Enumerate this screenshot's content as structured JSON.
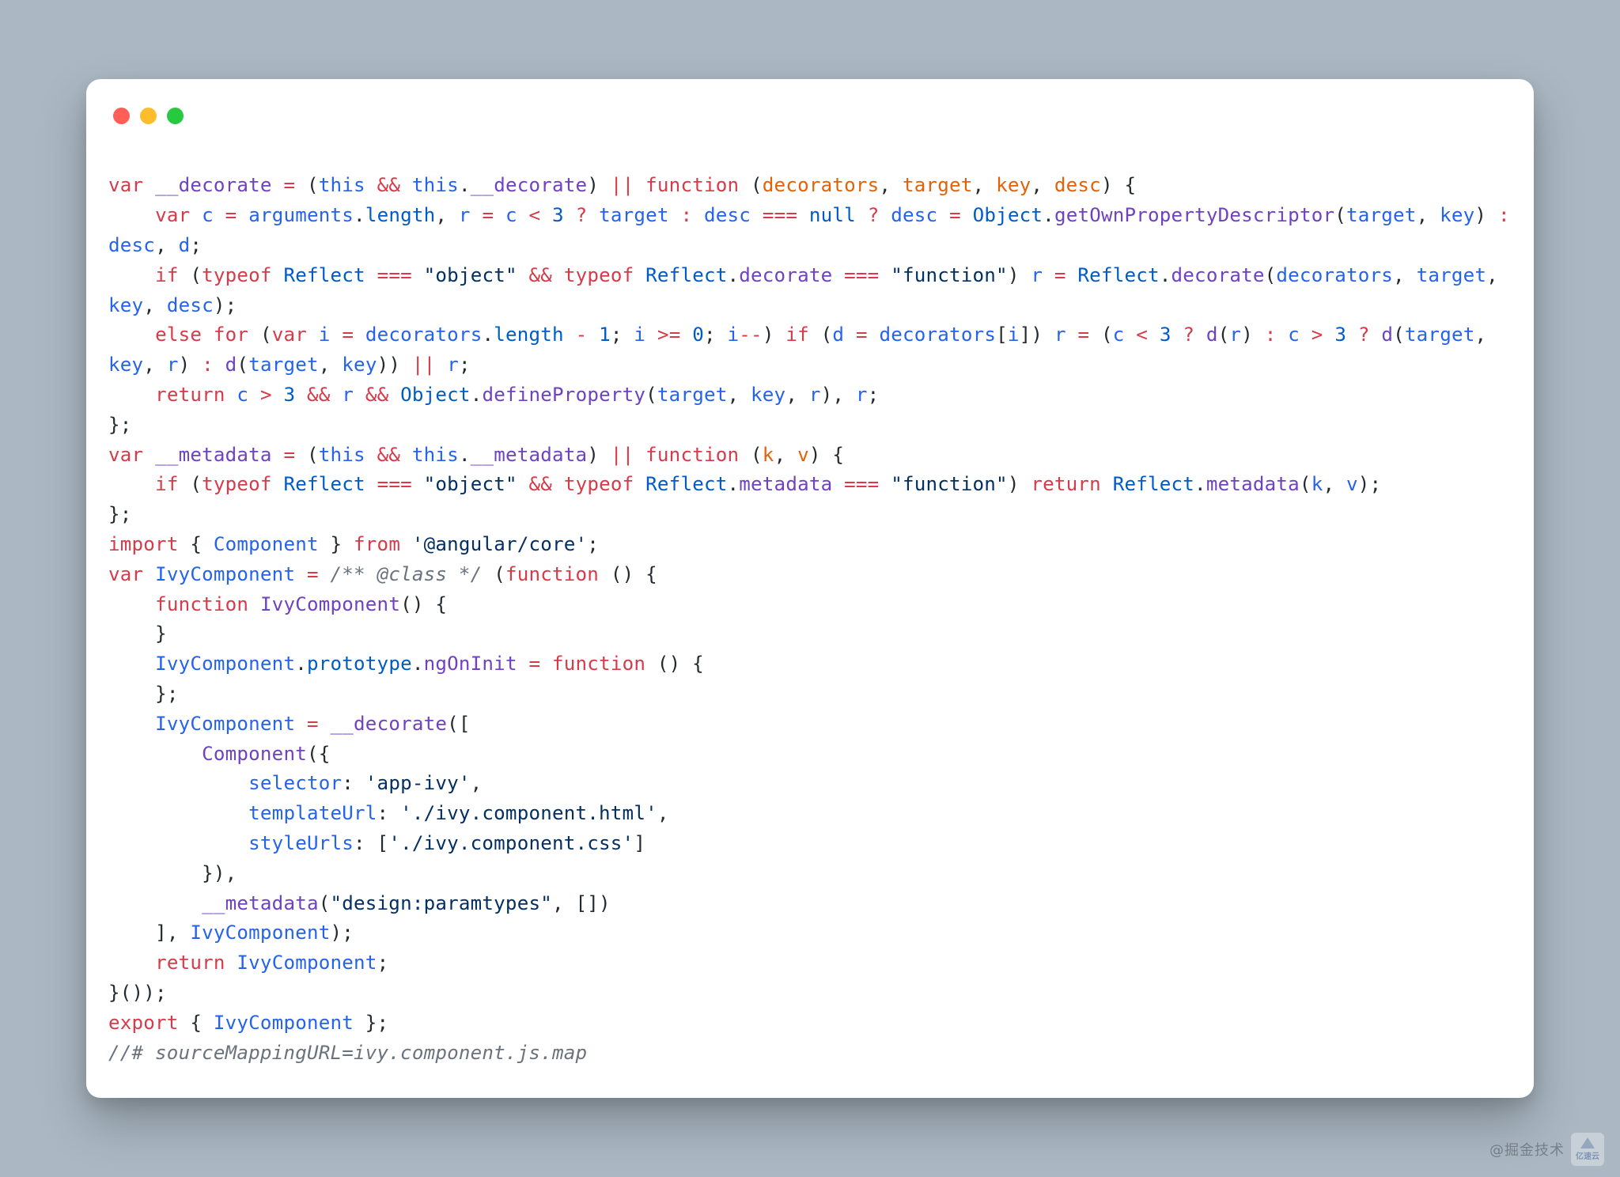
{
  "window": {
    "dot_colors": {
      "red": "#ff5f56",
      "yellow": "#ffbd2e",
      "green": "#27c93f"
    }
  },
  "syntax_colors": {
    "keyword": "#d73a49",
    "function": "#6f42c1",
    "identifier": "#2563eb",
    "property": "#005cc5",
    "number": "#005cc5",
    "string": "#032f62",
    "param": "#e36209",
    "comment": "#6a737d",
    "plain": "#24292e"
  },
  "code_meta": {
    "language": "javascript",
    "file_guess": "ivy.component.js"
  },
  "t": {
    "var": "var",
    "this": "this",
    "function": "function",
    "if": "if",
    "else": "else",
    "for": "for",
    "typeof": "typeof",
    "return": "return",
    "import": "import",
    "from": "from",
    "export": "export",
    "null": "null",
    "__decorate": "__decorate",
    "__metadata": "__metadata",
    "decorators": "decorators",
    "target": "target",
    "key": "key",
    "desc": "desc",
    "c": "c",
    "arguments": "arguments",
    "length": "length",
    "r": "r",
    "d": "d",
    "i": "i",
    "k": "k",
    "v": "v",
    "Object": "Object",
    "getOwnPropertyDescriptor": "getOwnPropertyDescriptor",
    "defineProperty": "defineProperty",
    "Reflect": "Reflect",
    "decorate": "decorate",
    "metadata": "metadata",
    "Component": "Component",
    "IvyComponent": "IvyComponent",
    "prototype": "prototype",
    "ngOnInit": "ngOnInit",
    "selector": "selector",
    "templateUrl": "templateUrl",
    "styleUrls": "styleUrls",
    "n3": "3",
    "n1": "1",
    "n0": "0",
    "s_object": "\"object\"",
    "s_function": "\"function\"",
    "s_angular_core": "'@angular/core'",
    "s_app_ivy": "'app-ivy'",
    "s_tpl": "'./ivy.component.html'",
    "s_css": "'./ivy.component.css'",
    "s_design_paramtypes": "\"design:paramtypes\"",
    "class_comment": "/** @class */",
    "source_map_comment": "//# sourceMappingURL=ivy.component.js.map",
    "indent1": "    ",
    "indent2": "        ",
    "indent3": "            "
  },
  "watermark": {
    "text": "@掘金技术",
    "logo_label": "亿速云"
  }
}
